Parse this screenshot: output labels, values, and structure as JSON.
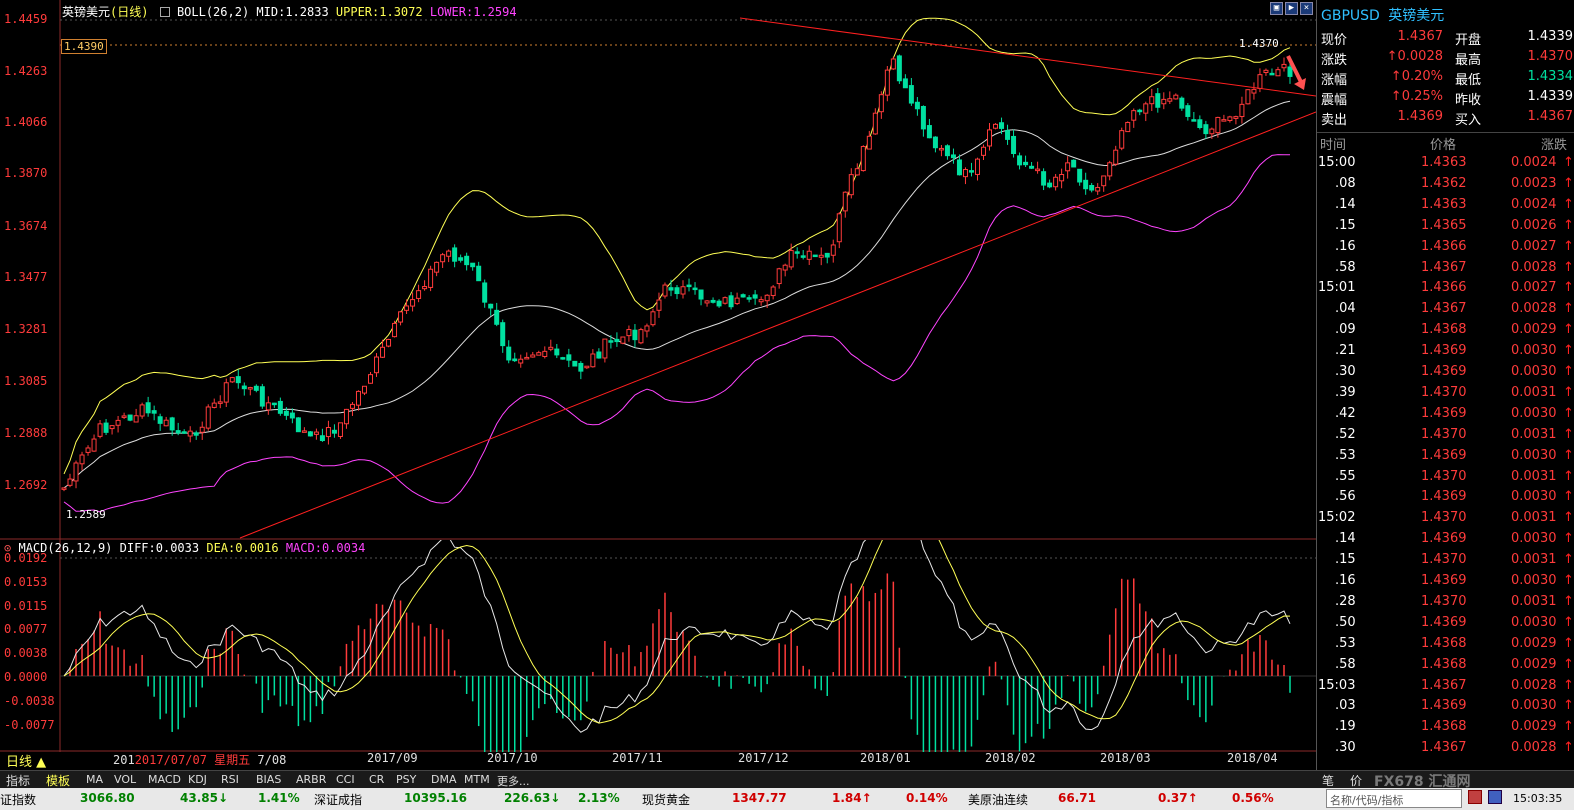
{
  "header": {
    "symbol": "英镑美元",
    "period": "(日线)",
    "boll_label": "BOLL(26,2)",
    "mid": "MID:1.2833",
    "upper": "UPPER:1.3072",
    "lower": "LOWER:1.2594"
  },
  "price_axis": [
    "1.4459",
    "1.4263",
    "1.4066",
    "1.3870",
    "1.3674",
    "1.3477",
    "1.3281",
    "1.3085",
    "1.2888",
    "1.2692"
  ],
  "price_marks": {
    "hline_label": "1.4390",
    "high_label": "1.4370",
    "low_label": "1.2589"
  },
  "macd_header": {
    "label": "MACD(26,12,9)",
    "diff": "DIFF:0.0033",
    "dea": "DEA:0.0016",
    "macd": "MACD:0.0034"
  },
  "macd_axis": [
    "0.0192",
    "0.0153",
    "0.0115",
    "0.0077",
    "0.0038",
    "0.0000",
    "-0.0038",
    "-0.0077"
  ],
  "x_axis": {
    "period_btn": "日线 ▲",
    "date_prefix": "201",
    "date_current": "2017/07/07 星期五",
    "date_suffix": "7/08",
    "months": [
      "2017/09",
      "2017/10",
      "2017/11",
      "2017/12",
      "2018/01",
      "2018/02",
      "2018/03",
      "2018/04"
    ]
  },
  "right_panel": {
    "code": "GBPUSD",
    "name": "英镑美元",
    "quote": [
      {
        "l1": "现价",
        "v1": "1.4367",
        "l2": "开盘",
        "v2": "1.4339",
        "v1c": "red",
        "v2c": "white"
      },
      {
        "l1": "涨跌",
        "v1": "↑0.0028",
        "l2": "最高",
        "v2": "1.4370",
        "v1c": "red",
        "v2c": "red"
      },
      {
        "l1": "涨幅",
        "v1": "↑0.20%",
        "l2": "最低",
        "v2": "1.4334",
        "v1c": "red",
        "v2c": "green"
      },
      {
        "l1": "震幅",
        "v1": "↑0.25%",
        "l2": "昨收",
        "v2": "1.4339",
        "v1c": "red",
        "v2c": "white"
      },
      {
        "l1": "卖出",
        "v1": "1.4369",
        "l2": "买入",
        "v2": "1.4367",
        "v1c": "red",
        "v2c": "red"
      }
    ],
    "tick_headers": [
      "时间",
      "价格",
      "涨跌"
    ],
    "ticks": [
      {
        "t": "15:00",
        "p": "1.4363",
        "c": "0.0024"
      },
      {
        "t": ".08",
        "p": "1.4362",
        "c": "0.0023"
      },
      {
        "t": ".14",
        "p": "1.4363",
        "c": "0.0024"
      },
      {
        "t": ".15",
        "p": "1.4365",
        "c": "0.0026"
      },
      {
        "t": ".16",
        "p": "1.4366",
        "c": "0.0027"
      },
      {
        "t": ".58",
        "p": "1.4367",
        "c": "0.0028"
      },
      {
        "t": "15:01",
        "p": "1.4366",
        "c": "0.0027"
      },
      {
        "t": ".04",
        "p": "1.4367",
        "c": "0.0028"
      },
      {
        "t": ".09",
        "p": "1.4368",
        "c": "0.0029"
      },
      {
        "t": ".21",
        "p": "1.4369",
        "c": "0.0030"
      },
      {
        "t": ".30",
        "p": "1.4369",
        "c": "0.0030"
      },
      {
        "t": ".39",
        "p": "1.4370",
        "c": "0.0031"
      },
      {
        "t": ".42",
        "p": "1.4369",
        "c": "0.0030"
      },
      {
        "t": ".52",
        "p": "1.4370",
        "c": "0.0031"
      },
      {
        "t": ".53",
        "p": "1.4369",
        "c": "0.0030"
      },
      {
        "t": ".55",
        "p": "1.4370",
        "c": "0.0031"
      },
      {
        "t": ".56",
        "p": "1.4369",
        "c": "0.0030"
      },
      {
        "t": "15:02",
        "p": "1.4370",
        "c": "0.0031"
      },
      {
        "t": ".14",
        "p": "1.4369",
        "c": "0.0030"
      },
      {
        "t": ".15",
        "p": "1.4370",
        "c": "0.0031"
      },
      {
        "t": ".16",
        "p": "1.4369",
        "c": "0.0030"
      },
      {
        "t": ".28",
        "p": "1.4370",
        "c": "0.0031"
      },
      {
        "t": ".50",
        "p": "1.4369",
        "c": "0.0030"
      },
      {
        "t": ".53",
        "p": "1.4368",
        "c": "0.0029"
      },
      {
        "t": ".58",
        "p": "1.4368",
        "c": "0.0029"
      },
      {
        "t": "15:03",
        "p": "1.4367",
        "c": "0.0028"
      },
      {
        "t": ".03",
        "p": "1.4369",
        "c": "0.0030"
      },
      {
        "t": ".19",
        "p": "1.4368",
        "c": "0.0029"
      },
      {
        "t": ".30",
        "p": "1.4367",
        "c": "0.0028"
      }
    ],
    "bottom": [
      "笔",
      "价"
    ]
  },
  "bottom_tabs": [
    "指标",
    "模板",
    "MA",
    "VOL",
    "MACD",
    "KDJ",
    "RSI",
    "BIAS",
    "ARBR",
    "CCI",
    "CR",
    "PSY",
    "DMA",
    "MTM",
    "更多..."
  ],
  "status_bar": [
    {
      "name": "证指数",
      "v": "3066.80",
      "c": "43.85↓",
      "p": "1.41%"
    },
    {
      "name": "深证成指",
      "v": "10395.16",
      "c": "226.63↓",
      "p": "2.13%"
    },
    {
      "name": "现货黄金",
      "v": "1347.77",
      "c": "1.84↑",
      "p": "0.14%"
    },
    {
      "name": "美原油连续",
      "v": "66.71",
      "c": "0.37↑",
      "p": "0.56%"
    }
  ],
  "search_placeholder": "名称/代码/指标",
  "clock": "15:03:35",
  "watermark": "FX678 汇通网",
  "colors": {
    "up": "#ff3b3b",
    "down": "#00e0a0",
    "upper": "#ffff55",
    "mid": "#dddddd",
    "lower": "#ff44ff",
    "trend": "#ff2020"
  }
}
